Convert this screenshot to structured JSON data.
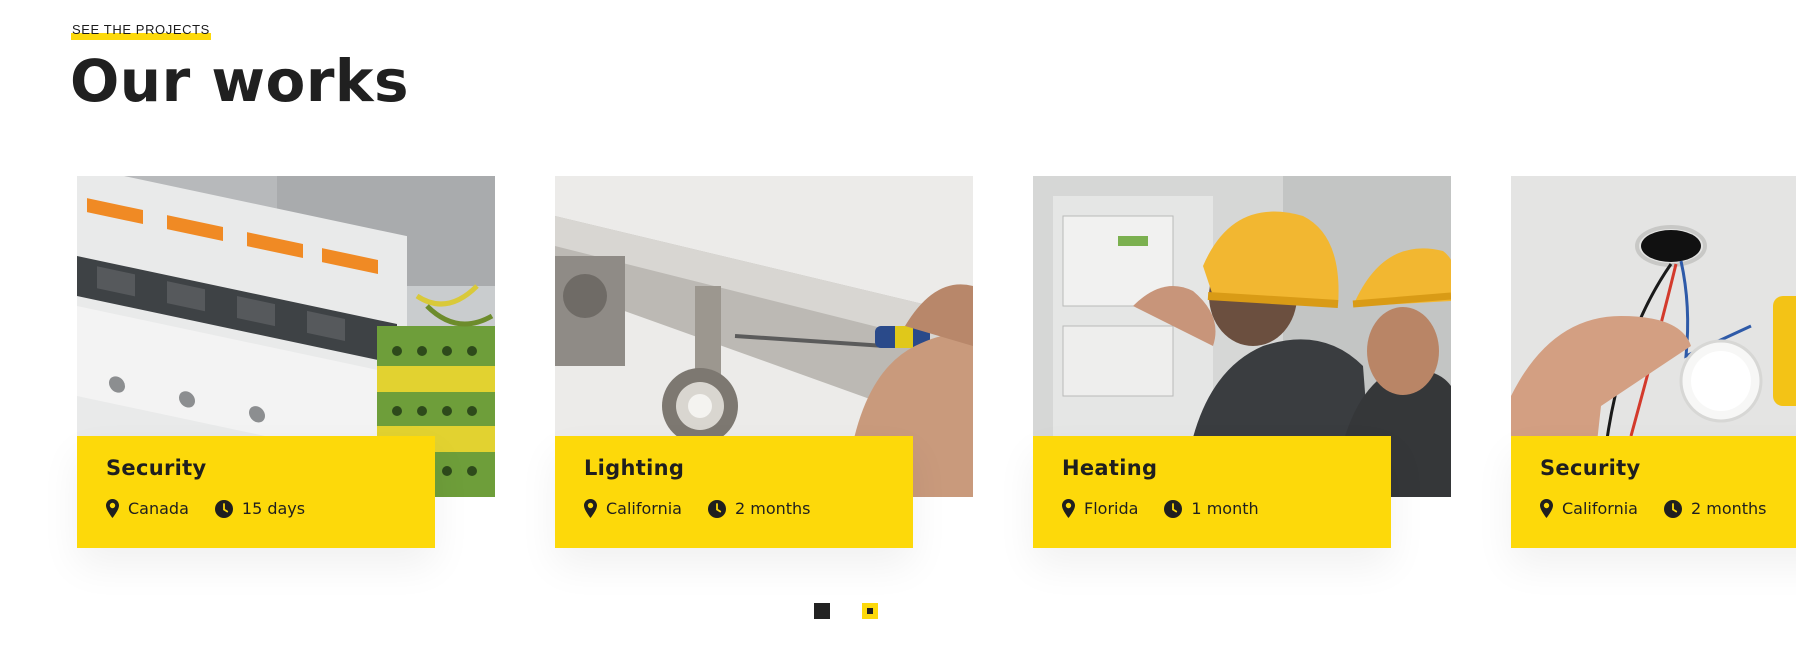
{
  "section": {
    "eyebrow": "SEE THE PROJECTS",
    "title": "Our works"
  },
  "colors": {
    "accent": "#fdd90a",
    "text": "#1f1f1f"
  },
  "projects": [
    {
      "title": "Security",
      "location": "Canada",
      "duration": "15 days",
      "image": "circuit-breaker-panel-photo"
    },
    {
      "title": "Lighting",
      "location": "California",
      "duration": "2 months",
      "image": "ceiling-spotlight-installation-photo"
    },
    {
      "title": "Heating",
      "location": "Florida",
      "duration": "1 month",
      "image": "electricians-with-hard-hats-photo"
    },
    {
      "title": "Security",
      "location": "California",
      "duration": "2 months",
      "image": "wiring-with-multimeter-photo"
    }
  ],
  "icons": {
    "location": "map-pin-icon",
    "duration": "clock-icon"
  },
  "pagination": {
    "pages": 2,
    "current": 2
  }
}
